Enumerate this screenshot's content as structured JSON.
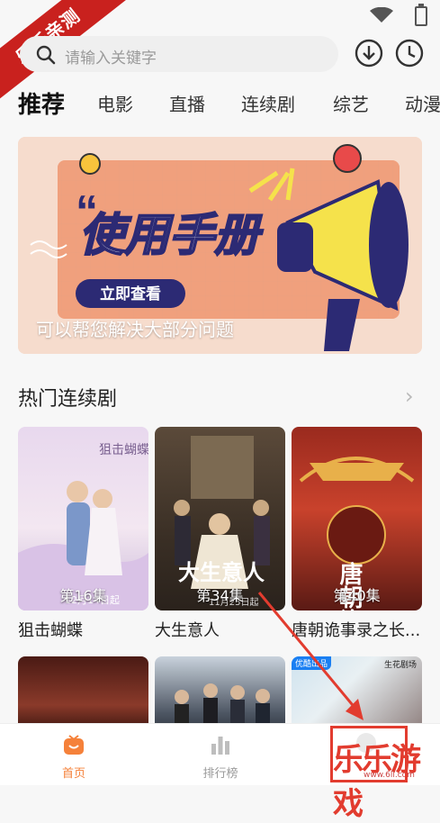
{
  "corner_badge": "乐乐亲测",
  "search": {
    "placeholder": "请输入关键字"
  },
  "tabs": [
    "推荐",
    "电影",
    "直播",
    "连续剧",
    "综艺",
    "动漫"
  ],
  "banner": {
    "heading": "使用手册",
    "button": "立即查看",
    "caption": "可以帮您解决大部分问题"
  },
  "section": {
    "title": "热门连续剧"
  },
  "dramas": [
    {
      "title": "狙击蝴蝶",
      "episodes": "第16集",
      "poster_text": "狙击蝴蝶",
      "poster_date": "12月14日起"
    },
    {
      "title": "大生意人",
      "episodes": "第34集",
      "poster_text": "大生意人",
      "poster_date": "11月25日起"
    },
    {
      "title": "唐朝诡事录之长...",
      "episodes": "第40集",
      "poster_text": "唐朝诡事录"
    }
  ],
  "row2_badges": [
    "优酷出品",
    "生花剧场"
  ],
  "bottom_nav": [
    {
      "label": "首页",
      "active": true,
      "icon": "home-icon"
    },
    {
      "label": "排行榜",
      "active": false,
      "icon": "bar-chart-icon"
    }
  ],
  "watermark": {
    "brand": "乐乐游戏",
    "site": "www.6ll.com"
  },
  "colors": {
    "accent": "#f5813a",
    "corner": "#c9211e",
    "annotation": "#e23c2f"
  }
}
